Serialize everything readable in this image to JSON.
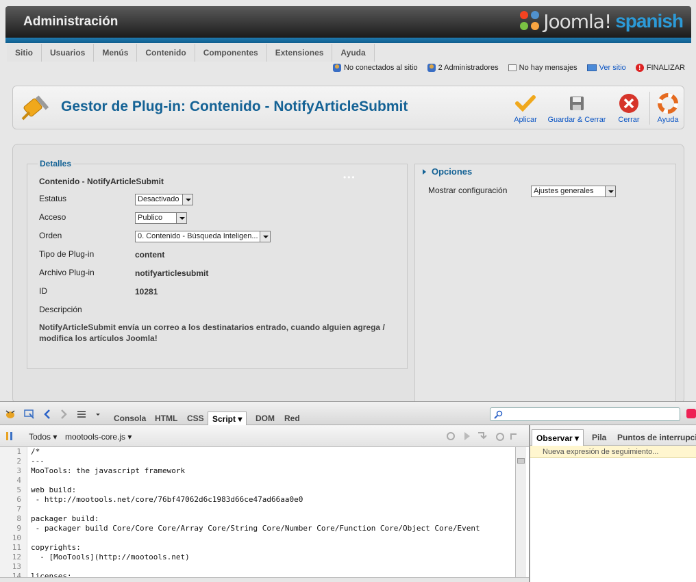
{
  "header": {
    "title": "Administración",
    "logo_text": "Joomla!",
    "logo_suffix": "spanish"
  },
  "menu": [
    "Sitio",
    "Usuarios",
    "Menús",
    "Contenido",
    "Componentes",
    "Extensiones",
    "Ayuda"
  ],
  "status": {
    "offline": "No conectados al sitio",
    "admins": "2 Administradores",
    "messages": "No hay mensajes",
    "view_site": "Ver sitio",
    "logout": "FINALIZAR"
  },
  "toolbar": {
    "title": "Gestor de Plug-in: Contenido - NotifyArticleSubmit",
    "apply": "Aplicar",
    "save_close": "Guardar & Cerrar",
    "close": "Cerrar",
    "help": "Ayuda"
  },
  "details": {
    "legend": "Detalles",
    "name": "Contenido - NotifyArticleSubmit",
    "status_label": "Estatus",
    "status_value": "Desactivado",
    "access_label": "Acceso",
    "access_value": "Publico",
    "order_label": "Orden",
    "order_value": "0. Contenido - Búsqueda Inteligen...",
    "type_label": "Tipo de Plug-in",
    "type_value": "content",
    "file_label": "Archivo Plug-in",
    "file_value": "notifyarticlesubmit",
    "id_label": "ID",
    "id_value": "10281",
    "desc_label": "Descripción",
    "description": "NotifyArticleSubmit envía un correo a los destinatarios entrado, cuando alguien agrega / modifica los artículos Joomla!"
  },
  "options": {
    "title": "Opciones",
    "show_config_label": "Mostrar configuración",
    "show_config_value": "Ajustes generales"
  },
  "firebug": {
    "tabs": [
      "Consola",
      "HTML",
      "CSS",
      "Script",
      "DOM",
      "Red"
    ],
    "active_tab": "Script",
    "filter": "Todos",
    "file": "mootools-core.js",
    "side_tabs": [
      "Observar",
      "Pila",
      "Puntos de interrupción"
    ],
    "watch_placeholder": "Nueva expresión de seguimiento...",
    "code": [
      "/*",
      "---",
      "MooTools: the javascript framework",
      "",
      "web build:",
      " - http://mootools.net/core/76bf47062d6c1983d66ce47ad66aa0e0",
      "",
      "packager build:",
      " - packager build Core/Core Core/Array Core/String Core/Number Core/Function Core/Object Core/Event",
      "",
      "copyrights:",
      "  - [MooTools](http://mootools.net)",
      "",
      "licenses:"
    ]
  },
  "colors": {
    "accent": "#146295",
    "blue_bar": "#1f7ab0",
    "link": "#0b55c4"
  }
}
